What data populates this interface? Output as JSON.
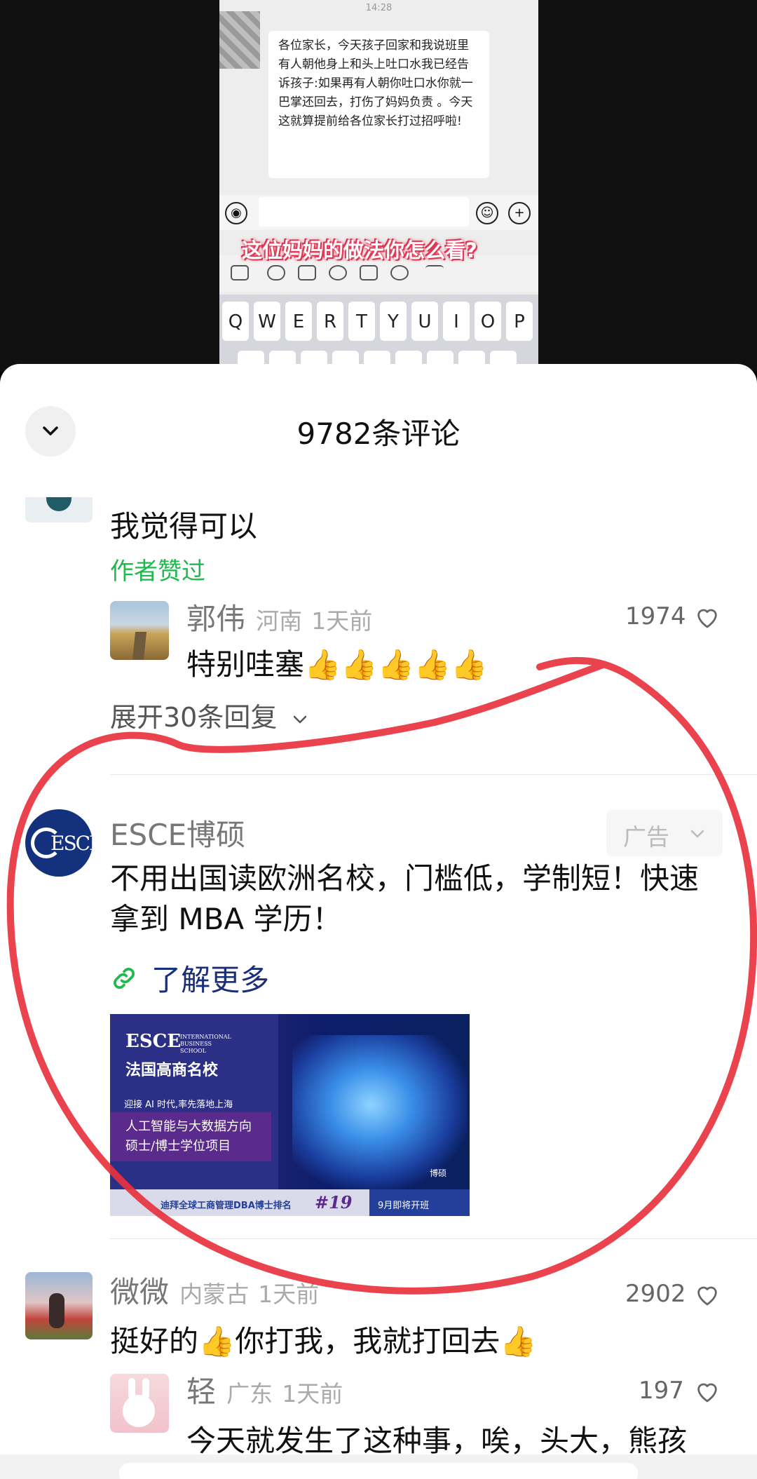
{
  "video": {
    "status_time": "14:28",
    "chat_message": "各位家长，今天孩子回家和我说班里有人朝他身上和头上吐口水我已经告诉孩子:如果再有人朝你吐口水你就一巴掌还回去，打伤了妈妈负责 。今天这就算提前给各位家长打过招呼啦!",
    "caption": "这位妈妈的做法你怎么看?",
    "keys": [
      "Q",
      "W",
      "E",
      "R",
      "T",
      "Y",
      "U",
      "I",
      "O",
      "P"
    ]
  },
  "sheet": {
    "title": "9782条评论",
    "comments": [
      {
        "text": "我觉得可以",
        "author_liked": "作者赞过",
        "reply": {
          "user": "郭伟",
          "location": "河南",
          "time": "1天前",
          "likes": "1974",
          "text": "特别哇塞👍👍👍👍👍"
        },
        "expand": "展开30条回复"
      },
      {
        "user": "微微",
        "location": "内蒙古",
        "time": "1天前",
        "likes": "2902",
        "text": "挺好的👍你打我，我就打回去👍",
        "reply": {
          "user": "轻",
          "location": "广东",
          "time": "1天前",
          "likes": "197",
          "text": "今天就发生了这种事，唉，头大，熊孩"
        }
      }
    ],
    "ad": {
      "advertiser": "ESCE博硕",
      "tag": "广告",
      "text": "不用出国读欧洲名校，门槛低，学制短！快速拿到 MBA 学历！",
      "link": "了解更多",
      "image": {
        "brand": "ESCE",
        "brand_sub": "INTERNATIONAL BUSINESS SCHOOL",
        "headline": "法国高商名校",
        "tagline": "迎接 AI 时代,率先落地上海",
        "program1": "人工智能与大数据方向",
        "program2": "硕士/博士学位项目",
        "corner": "博硕",
        "rank_text": "迪拜全球工商管理DBA博士排名",
        "rank": "#19",
        "enroll": "9月即将开班"
      }
    },
    "colors": {
      "author_liked": "#22b84f",
      "link": "#1a2f7a",
      "annotation": "#e8333f"
    }
  }
}
